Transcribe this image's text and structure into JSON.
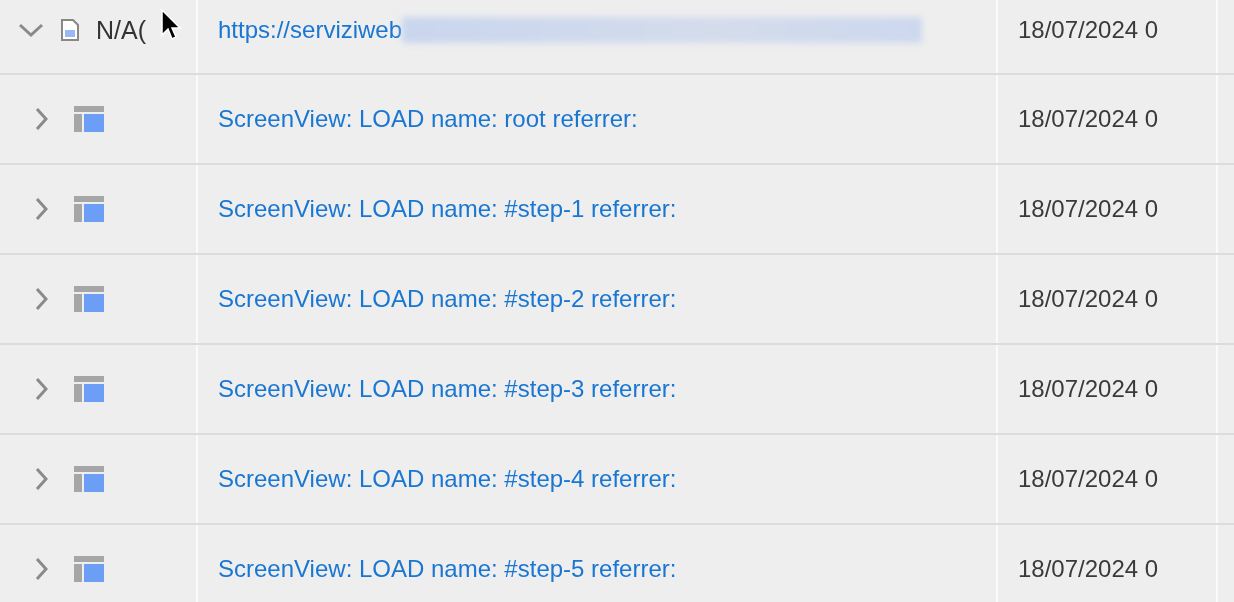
{
  "rows": [
    {
      "kind": "page",
      "expanded": true,
      "name": "N/A(",
      "link": "https://serviziweb",
      "link_blurred": true,
      "date": "18/07/2024 0",
      "children": [
        {
          "kind": "screen",
          "expanded": false,
          "link": "ScreenView: LOAD name: root referrer:",
          "date": "18/07/2024 0"
        },
        {
          "kind": "screen",
          "expanded": false,
          "link": "ScreenView: LOAD name: #step-1 referrer:",
          "date": "18/07/2024 0"
        },
        {
          "kind": "screen",
          "expanded": false,
          "link": "ScreenView: LOAD name: #step-2 referrer:",
          "date": "18/07/2024 0"
        },
        {
          "kind": "screen",
          "expanded": false,
          "link": "ScreenView: LOAD name: #step-3 referrer:",
          "date": "18/07/2024 0"
        },
        {
          "kind": "screen",
          "expanded": false,
          "link": "ScreenView: LOAD name: #step-4 referrer:",
          "date": "18/07/2024 0"
        },
        {
          "kind": "screen",
          "expanded": false,
          "link": "ScreenView: LOAD name: #step-5 referrer:",
          "date": "18/07/2024 0"
        }
      ]
    }
  ]
}
